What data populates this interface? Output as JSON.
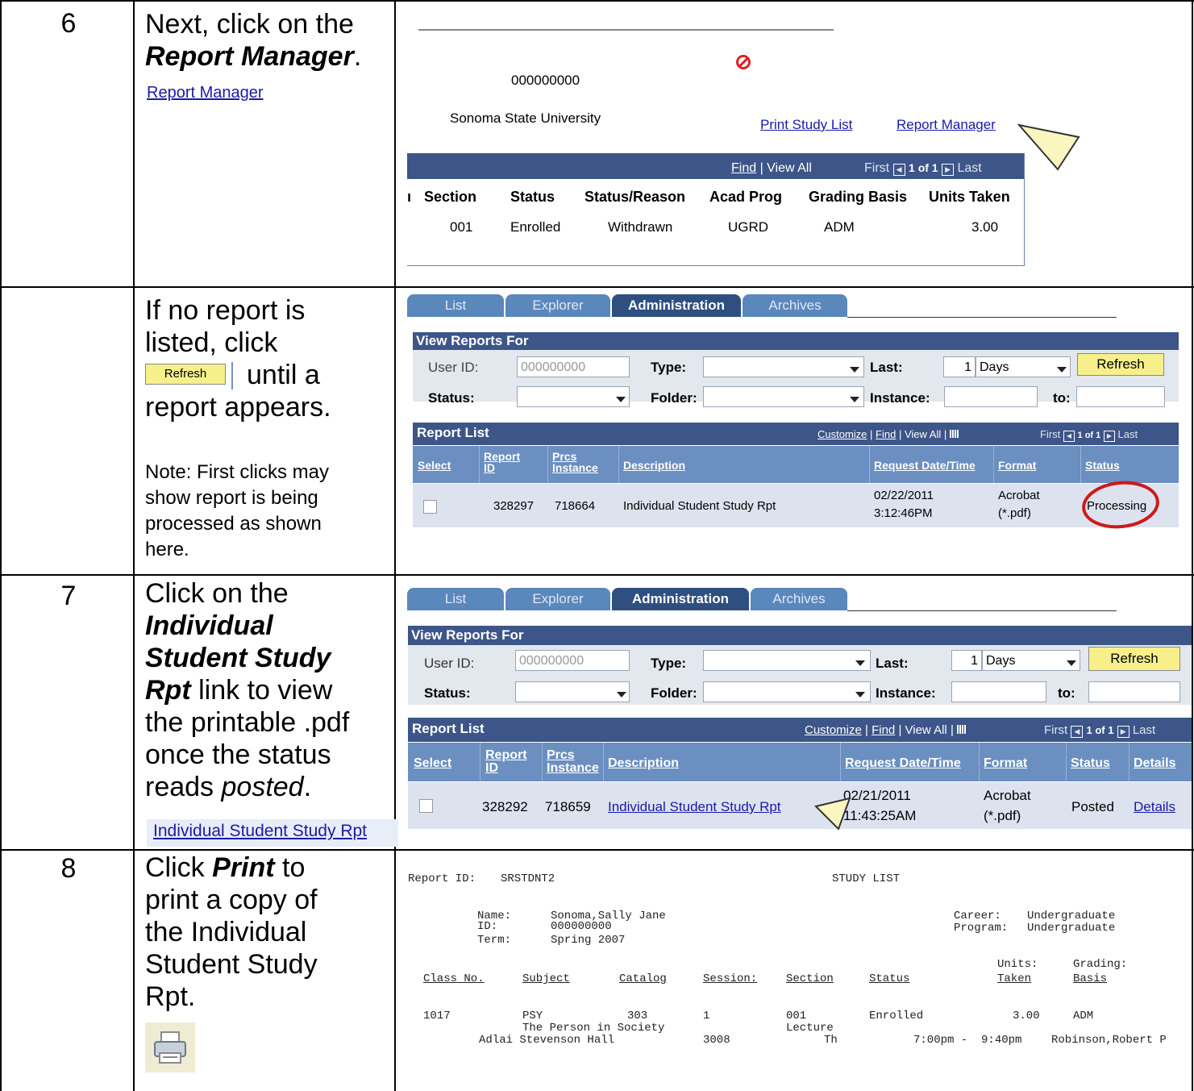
{
  "rows": [
    {
      "step": "6",
      "instruction": {
        "pre": "Next, click on the",
        "bold": "Report Manager",
        "post": "."
      },
      "link_label": "Report Manager",
      "shot": {
        "user_id": "000000000",
        "institution": "Sonoma State University",
        "links": [
          "Print Study List",
          "Report Manager"
        ],
        "nav": {
          "find": "Find",
          "view_all": "View All",
          "first": "First",
          "count": "1 of 1",
          "last": "Last"
        },
        "headers": [
          "Section",
          "Status",
          "Status/Reason",
          "Acad Prog",
          "Grading Basis",
          "Units Taken"
        ],
        "values": [
          "001",
          "Enrolled",
          "Withdrawn",
          "UGRD",
          "ADM",
          "3.00"
        ]
      }
    },
    {
      "step": "",
      "instruction": {
        "line1": "If no report is",
        "line2": "listed, click",
        "button": "Refresh",
        "line3": "until a",
        "line4": "report appears."
      },
      "note": [
        "Note: First clicks may",
        "show report is being",
        "processed as shown",
        "here."
      ],
      "shot": {
        "tabs": [
          "List",
          "Explorer",
          "Administration",
          "Archives"
        ],
        "view_reports_for": "View Reports For",
        "user_id_label": "User ID:",
        "user_id": "000000000",
        "type_label": "Type:",
        "last_label": "Last:",
        "last_value": "1",
        "days": "Days",
        "refresh": "Refresh",
        "status_label": "Status:",
        "folder_label": "Folder:",
        "instance_label": "Instance:",
        "to_label": "to:",
        "report_list": "Report List",
        "list_nav": {
          "customize": "Customize",
          "find": "Find",
          "view_all": "View All",
          "first": "First",
          "count": "1 of 1",
          "last": "Last"
        },
        "col_headers": {
          "select": "Select",
          "report_id_a": "Report",
          "report_id_b": "ID",
          "prcs_a": "Prcs",
          "prcs_b": "Instance",
          "description": "Description",
          "request": "Request Date/Time",
          "format": "Format",
          "status": "Status"
        },
        "row": {
          "report_id": "328297",
          "prcs": "718664",
          "description": "Individual Student Study Rpt",
          "date": "02/22/2011",
          "time": "3:12:46PM",
          "format_a": "Acrobat",
          "format_b": "(*.pdf)",
          "status": "Processing"
        }
      }
    },
    {
      "step": "7",
      "instruction": {
        "pre": "Click on the",
        "bold1": "Individual",
        "bold2": "Student Study",
        "bold3": "Rpt",
        "post1": " link to view",
        "line5": "the printable .pdf",
        "line6": "once the status",
        "pre7": "reads ",
        "italic": "posted",
        "post7": "."
      },
      "link_label": "Individual Student Study Rpt",
      "shot": {
        "tabs": [
          "List",
          "Explorer",
          "Administration",
          "Archives"
        ],
        "view_reports_for": "View Reports For",
        "user_id_label": "User ID:",
        "user_id": "000000000",
        "type_label": "Type:",
        "last_label": "Last:",
        "last_value": "1",
        "days": "Days",
        "refresh": "Refresh",
        "status_label": "Status:",
        "folder_label": "Folder:",
        "instance_label": "Instance:",
        "to_label": "to:",
        "report_list": "Report List",
        "list_nav": {
          "customize": "Customize",
          "find": "Find",
          "view_all": "View All",
          "first": "First",
          "count": "1 of 1",
          "last": "Last"
        },
        "col_headers": {
          "select": "Select",
          "report_id_a": "Report",
          "report_id_b": "ID",
          "prcs_a": "Prcs",
          "prcs_b": "Instance",
          "description": "Description",
          "request": "Request Date/Time",
          "format": "Format",
          "status": "Status",
          "details": "Details"
        },
        "row": {
          "report_id": "328292",
          "prcs": "718659",
          "description": "Individual Student Study Rpt",
          "date": "02/21/2011",
          "time": "11:43:25AM",
          "format_a": "Acrobat",
          "format_b": "(*.pdf)",
          "status": "Posted",
          "details": "Details"
        }
      }
    },
    {
      "step": "8",
      "instruction": {
        "pre": "Click ",
        "bold": "Print",
        "post": " to",
        "line2": "print a copy of",
        "line3": "the Individual",
        "line4": "Student Study",
        "line5": "Rpt."
      },
      "shot": {
        "report_id_label": "Report ID:",
        "report_id": "SRSTDNT2",
        "title": "STUDY LIST",
        "name_label": "Name:",
        "name": "Sonoma,Sally Jane",
        "id_label": "ID:",
        "id": "000000000",
        "term_label": "Term:",
        "term": "Spring 2007",
        "career_label": "Career:",
        "career": "Undergraduate",
        "program_label": "Program:",
        "program": "Undergraduate",
        "headers": {
          "class_no": "Class No.",
          "subject": "Subject",
          "catalog": "Catalog",
          "session": "Session:",
          "section": "Section",
          "status": "Status",
          "units_a": "Units:",
          "units_b": "Taken",
          "grading_a": "Grading:",
          "grading_b": "Basis"
        },
        "line1": {
          "class_no": "1017",
          "subject": "PSY",
          "catalog": "303",
          "session": "1",
          "section": "001",
          "status": "Enrolled",
          "units": "3.00",
          "grading": "ADM"
        },
        "line2": {
          "title": "The Person in Society",
          "component": "Lecture"
        },
        "line3": {
          "location": "Adlai Stevenson Hall",
          "room": "3008",
          "days": "Th",
          "time": "7:00pm -  9:40pm",
          "instructor": "Robinson,Robert P"
        }
      }
    }
  ]
}
